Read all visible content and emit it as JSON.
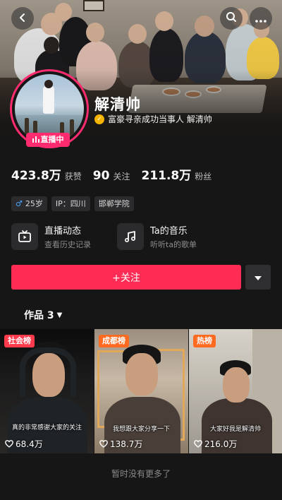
{
  "profile": {
    "name": "解清帅",
    "verification": "富豪寻亲成功当事人 解清帅",
    "live_badge": "直播中"
  },
  "stats": [
    {
      "value": "423.8万",
      "label": "获赞"
    },
    {
      "value": "90",
      "label": "关注"
    },
    {
      "value": "211.8万",
      "label": "粉丝"
    }
  ],
  "tags": {
    "age": "25岁",
    "gender_icon": "male-icon",
    "ip": "IP：四川",
    "school": "邯郸学院"
  },
  "features": {
    "live": {
      "title": "直播动态",
      "subtitle": "查看历史记录",
      "icon": "tv-icon"
    },
    "music": {
      "title": "Ta的音乐",
      "subtitle": "听听ta的歌单",
      "icon": "music-note-icon"
    }
  },
  "actions": {
    "follow_label": "+关注"
  },
  "works": {
    "tab_label": "作品 3"
  },
  "videos": [
    {
      "badge": "社会榜",
      "caption": "真的非常感谢大家的关注",
      "likes": "68.4万"
    },
    {
      "badge": "成都榜",
      "caption": "我想跟大家分享一下",
      "likes": "138.7万"
    },
    {
      "badge": "热榜",
      "caption": "大家好我是解清帅",
      "likes": "216.0万"
    }
  ],
  "footer": {
    "note": "暂时没有更多了"
  },
  "colors": {
    "accent": "#fe2c55",
    "live_ring": "#fe2c6f",
    "background": "#161616"
  }
}
